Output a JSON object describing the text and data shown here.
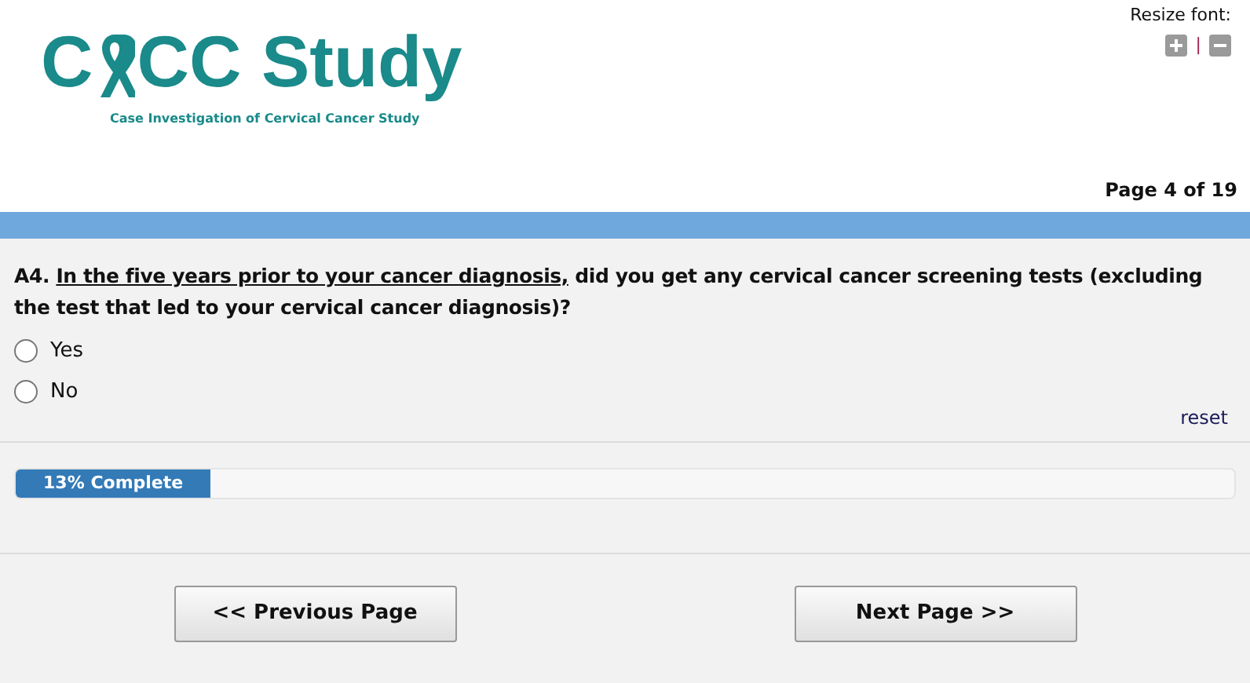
{
  "header": {
    "logo": {
      "before_ribbon": "C",
      "after_ribbon": "CC Study",
      "tagline": "Case Investigation of Cervical Cancer Study"
    },
    "resize_font": {
      "label": "Resize font:",
      "separator": "|"
    },
    "page_indicator": "Page 4 of 19"
  },
  "question": {
    "number": "A4.",
    "underlined": "In the five years prior to your cancer diagnosis,",
    "rest": "did you get any cervical cancer screening tests (excluding the test that led to your cervical cancer diagnosis)?",
    "options": [
      {
        "label": "Yes",
        "selected": false
      },
      {
        "label": "No",
        "selected": false
      }
    ],
    "reset": "reset"
  },
  "progress": {
    "label": "13% Complete",
    "level": 0.16
  },
  "buttons": [
    {
      "label": "<< Previous Page"
    },
    {
      "label": "Next Page >>"
    }
  ]
}
